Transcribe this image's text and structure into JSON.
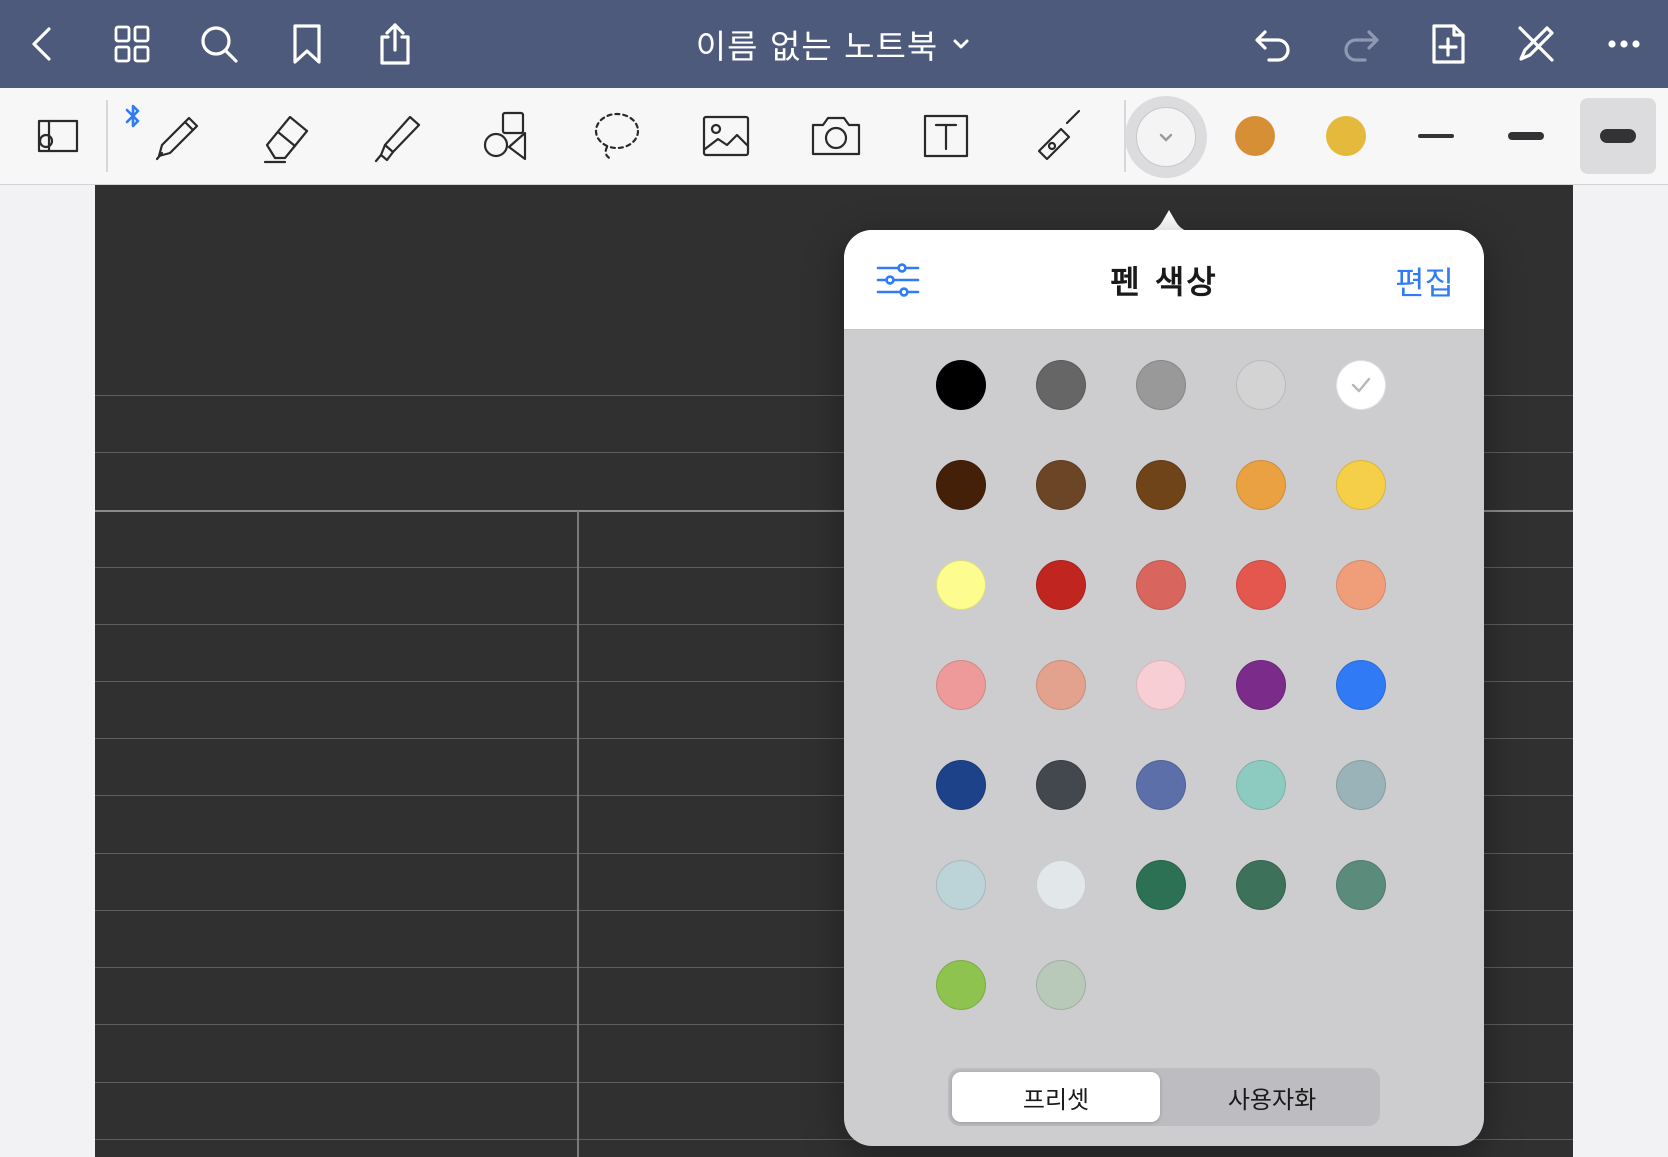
{
  "nav": {
    "title": "이름 없는 노트북",
    "back_icon": "chevron-left-icon",
    "grid_icon": "grid-icon",
    "search_icon": "search-icon",
    "bookmark_icon": "bookmark-icon",
    "share_icon": "share-icon",
    "undo_icon": "undo-icon",
    "redo_icon": "redo-icon",
    "add_page_icon": "add-page-icon",
    "no_pen_icon": "pencil-off-icon",
    "more_icon": "more-icon",
    "bar_color": "#4e5a7b"
  },
  "toolbar": {
    "tools": [
      "read-only-mode-icon",
      "pen-icon",
      "eraser-icon",
      "highlighter-icon",
      "shapes-icon",
      "lasso-icon",
      "image-icon",
      "camera-icon",
      "text-box-icon",
      "laser-pointer-icon"
    ],
    "bluetooth": "bluetooth-icon",
    "color_slots": [
      "#d78f36",
      "#e4b93c"
    ],
    "width_selected": 3
  },
  "popover": {
    "title": "펜 색상",
    "edit_label": "편집",
    "selected_color": "#ffffff",
    "swatches": [
      "#000000",
      "#666666",
      "#999999",
      "#d3d3d3",
      "#ffffff",
      "#442008",
      "#6b4525",
      "#6e4418",
      "#e9a141",
      "#f5cf47",
      "#fdfc8f",
      "#c0261f",
      "#d8665f",
      "#e3574f",
      "#f09e7a",
      "#ee9a9a",
      "#e2a28e",
      "#f7ced3",
      "#7b2b8a",
      "#307af6",
      "#1d4289",
      "#43474e",
      "#5d6fa9",
      "#8dcbc0",
      "#9ab3b8",
      "#bcd3d7",
      "#e2e8ea",
      "#2c7153",
      "#3e7159",
      "#5b8c7b",
      "#8ec34f",
      "#b8c8b9"
    ],
    "segments": [
      "프리셋",
      "사용자화"
    ],
    "segment_selected": 0
  }
}
